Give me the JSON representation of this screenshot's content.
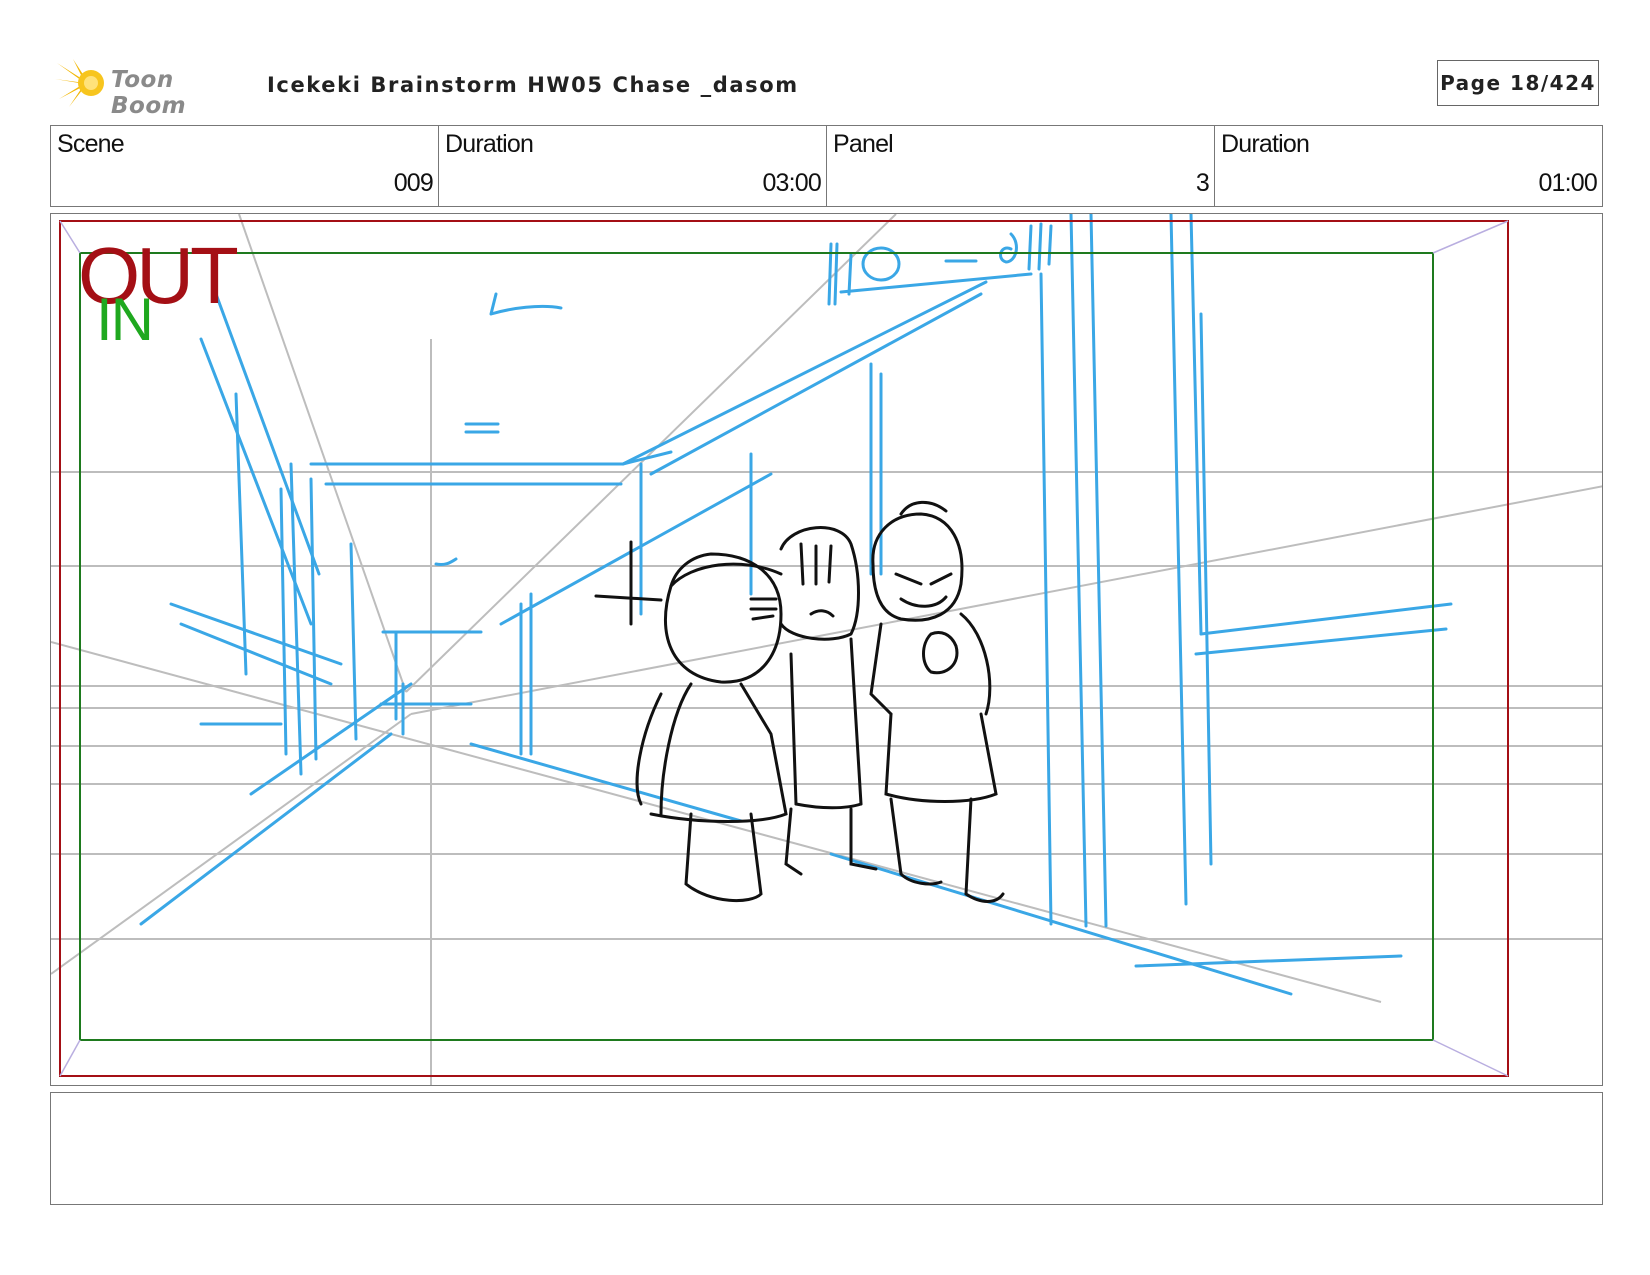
{
  "header": {
    "logo_text": "Toon Boom",
    "title": "Icekeki  Brainstorm HW05 Chase _dasom",
    "page": "Page  18/424"
  },
  "info": {
    "scene_label": "Scene",
    "scene_value": "009",
    "duration_label": "Duration",
    "duration_value": "03:00",
    "panel_label": "Panel",
    "panel_value": "3",
    "panel_duration_label": "Duration",
    "panel_duration_value": "01:00"
  },
  "panel": {
    "out_label": "OUT",
    "in_label": "IN",
    "content": "storyboard sketch: school corridor in perspective with three children standing together"
  },
  "colors": {
    "out_frame": "#a40f15",
    "in_frame": "#1e7a1e",
    "sketch_blue": "#3aa7e6",
    "sketch_black": "#111111",
    "guide_gray": "#bdbdbd",
    "logo_burst": "#f2b705"
  },
  "notes": {
    "text": ""
  }
}
